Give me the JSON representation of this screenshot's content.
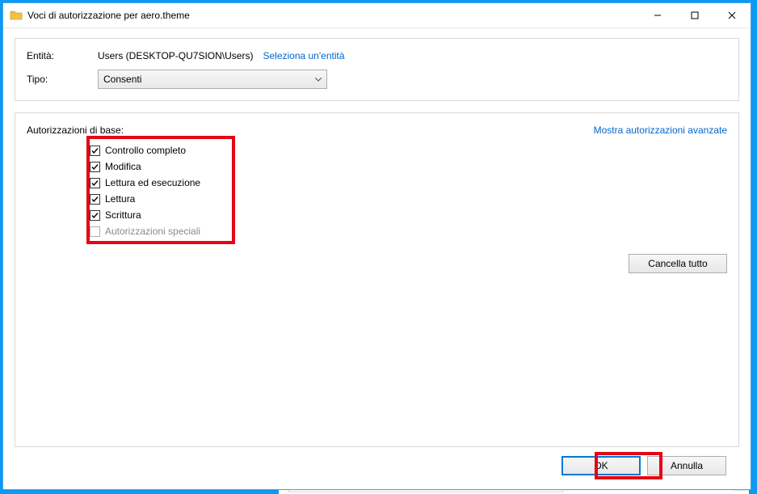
{
  "window": {
    "title": "Voci di autorizzazione per aero.theme",
    "icon": "folder-icon"
  },
  "header": {
    "entity_label": "Entità:",
    "entity_value": "Users (DESKTOP-QU7SION\\Users)",
    "select_entity_link": "Seleziona un'entità",
    "type_label": "Tipo:",
    "type_value": "Consenti"
  },
  "permissions": {
    "section_label": "Autorizzazioni di base:",
    "advanced_link": "Mostra autorizzazioni avanzate",
    "items": [
      {
        "label": "Controllo completo",
        "checked": true,
        "enabled": true
      },
      {
        "label": "Modifica",
        "checked": true,
        "enabled": true
      },
      {
        "label": "Lettura ed esecuzione",
        "checked": true,
        "enabled": true
      },
      {
        "label": "Lettura",
        "checked": true,
        "enabled": true
      },
      {
        "label": "Scrittura",
        "checked": true,
        "enabled": true
      },
      {
        "label": "Autorizzazioni speciali",
        "checked": false,
        "enabled": false
      }
    ],
    "clear_all": "Cancella tutto"
  },
  "footer": {
    "ok": "OK",
    "cancel": "Annulla"
  }
}
